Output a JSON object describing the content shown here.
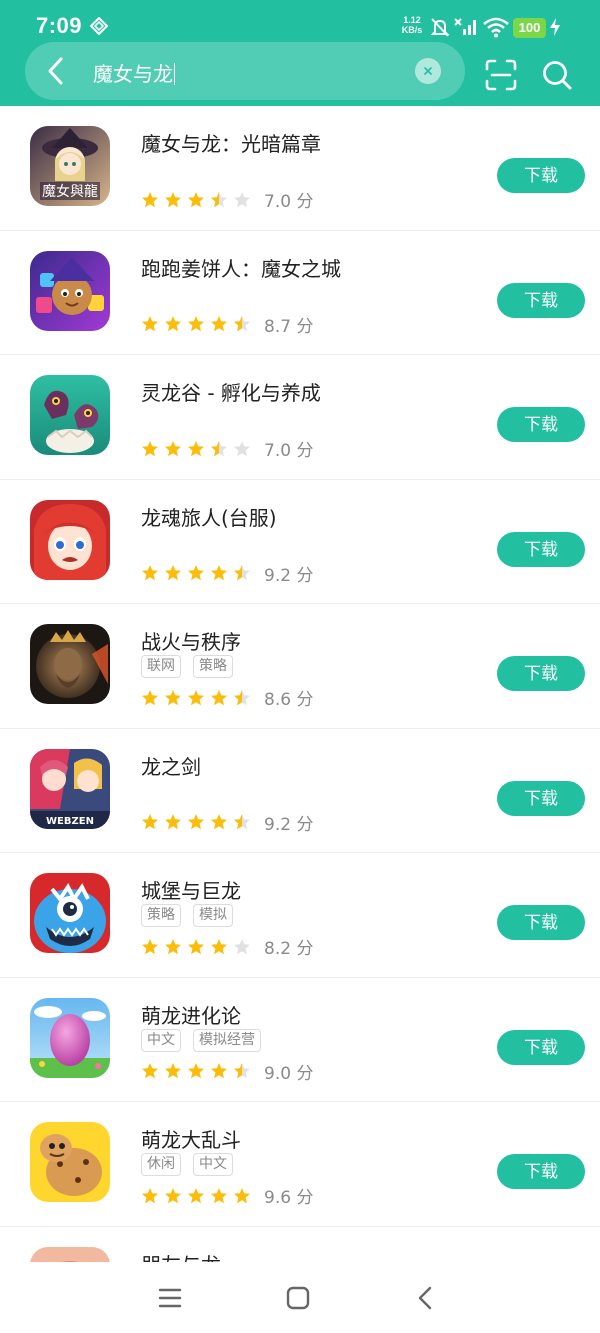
{
  "status_bar": {
    "time": "7:09",
    "speed_value": "1.12",
    "speed_unit": "KB/s",
    "battery": "100",
    "icons": [
      "diamond-icon",
      "mute-icon",
      "no-signal-icon",
      "wifi-icon",
      "battery-icon",
      "charging-icon"
    ]
  },
  "search": {
    "query": "魔女与龙",
    "icons": [
      "back-arrow-icon",
      "clear-icon",
      "scan-icon",
      "search-icon"
    ]
  },
  "colors": {
    "brand": "#22bfa0",
    "star_full": "#fbbc0a",
    "star_empty": "#e1e1e1",
    "battery": "#7cd64a"
  },
  "apps": [
    {
      "name": "魔女与龙：光暗篇章",
      "tags": [],
      "stars": 3.5,
      "score": "7.0 分",
      "button": "下载"
    },
    {
      "name": "跑跑姜饼人：魔女之城",
      "tags": [],
      "stars": 4.5,
      "score": "8.7 分",
      "button": "下载"
    },
    {
      "name": "灵龙谷 - 孵化与养成",
      "tags": [],
      "stars": 3.5,
      "score": "7.0 分",
      "button": "下载"
    },
    {
      "name": "龙魂旅人(台服)",
      "tags": [],
      "stars": 4.5,
      "score": "9.2 分",
      "button": "下载"
    },
    {
      "name": "战火与秩序",
      "tags": [
        "联网",
        "策略"
      ],
      "stars": 4.5,
      "score": "8.6 分",
      "button": "下载"
    },
    {
      "name": "龙之剑",
      "tags": [],
      "stars": 4.5,
      "score": "9.2 分",
      "button": "下载"
    },
    {
      "name": "城堡与巨龙",
      "tags": [
        "策略",
        "模拟"
      ],
      "stars": 4,
      "score": "8.2 分",
      "button": "下载"
    },
    {
      "name": "萌龙进化论",
      "tags": [
        "中文",
        "模拟经营"
      ],
      "stars": 4.5,
      "score": "9.0 分",
      "button": "下载"
    },
    {
      "name": "萌龙大乱斗",
      "tags": [
        "休闲",
        "中文"
      ],
      "stars": 5,
      "score": "9.6 分",
      "button": "下载"
    },
    {
      "name": "朋友与龙",
      "tags": [],
      "stars": 0,
      "score": "",
      "button": ""
    }
  ],
  "icon_art": [
    "witch-girl-icon",
    "cookie-witch-icon",
    "baby-dragon-icon",
    "red-hair-girl-icon",
    "king-portrait-icon",
    "anime-duo-icon",
    "blue-monster-icon",
    "pink-egg-icon",
    "cookie-dragon-icon",
    "friend-dragon-icon"
  ],
  "icon_watermarks": [
    "魔女與龍",
    "WEBZEN"
  ],
  "nav_bar": {
    "icons": [
      "menu-icon",
      "home-icon",
      "back-icon"
    ]
  }
}
